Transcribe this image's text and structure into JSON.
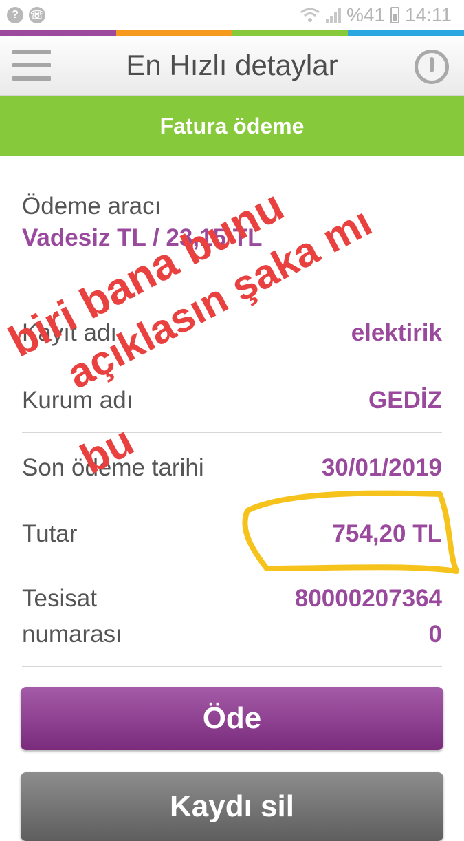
{
  "status_bar": {
    "icons": [
      "question-icon",
      "phone-icon",
      "wifi-icon",
      "signal-icon",
      "battery-icon"
    ],
    "battery": "%41",
    "time": "14:11"
  },
  "color_strip": [
    "#9b4a9d",
    "#f59a1d",
    "#86c93a",
    "#2aa6e0"
  ],
  "header": {
    "title": "En Hızlı detaylar",
    "menu_icon": "hamburger-icon",
    "power_icon": "power-icon"
  },
  "section": {
    "title": "Fatura ödeme"
  },
  "payment": {
    "label": "Ödeme aracı",
    "value": "Vadesiz TL / 23,15 TL"
  },
  "details": [
    {
      "label": "Kayıt adı",
      "value": "elektirik"
    },
    {
      "label": "Kurum adı",
      "value": "GEDİZ"
    },
    {
      "label": "Son ödeme tarihi",
      "value": "30/01/2019"
    },
    {
      "label": "Tutar",
      "value": "754,20 TL"
    },
    {
      "label_line1": "Tesisat",
      "label_line2": "numarası",
      "value_line1": "80000207364",
      "value_line2": "0"
    }
  ],
  "buttons": {
    "pay": "Öde",
    "delete": "Kaydı sil"
  },
  "annotation": {
    "lines": [
      "biri bana bunu",
      "açıklasın şaka mı",
      "bu"
    ],
    "color": "#e8413f",
    "highlight_color": "#f6c21c"
  },
  "colors": {
    "accent_purple": "#9a4a9c",
    "header_green": "#86c93a",
    "label_gray": "#555555"
  }
}
